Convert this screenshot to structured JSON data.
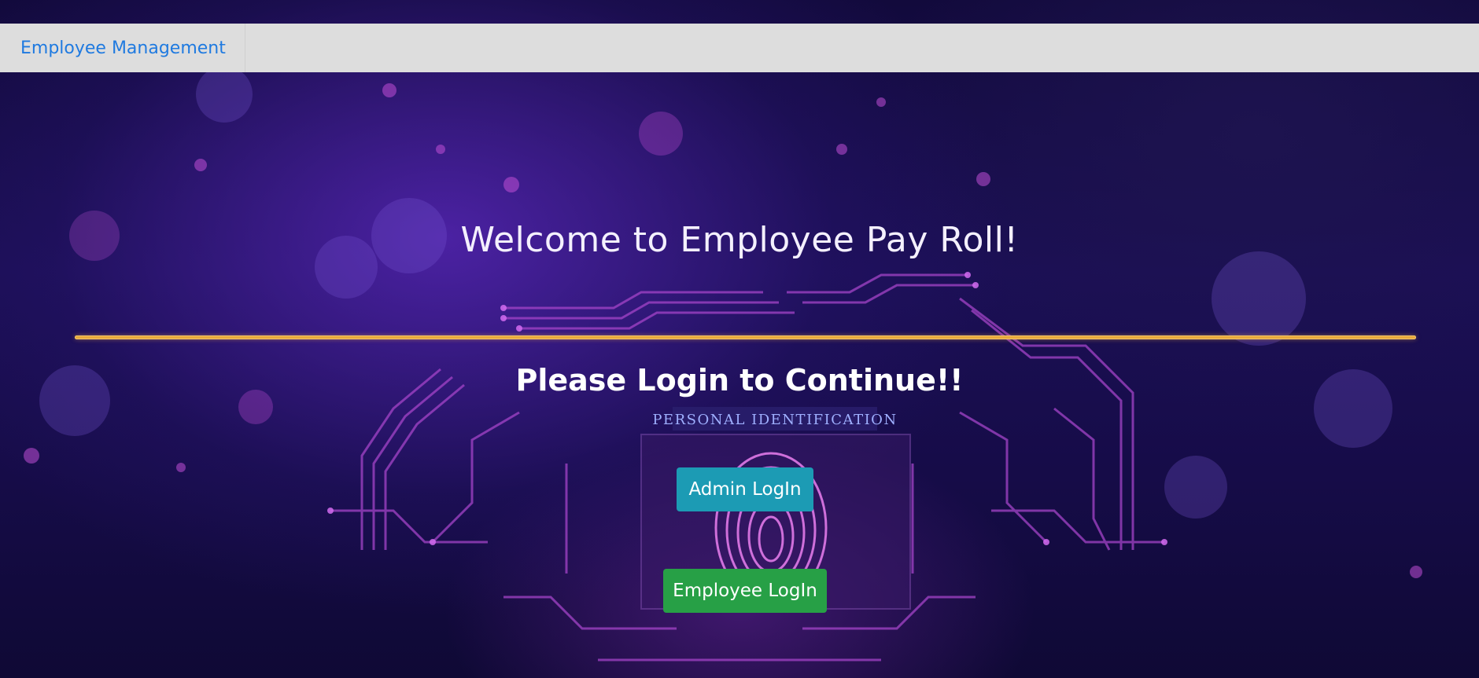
{
  "navbar": {
    "brand": "Employee Management"
  },
  "main": {
    "welcome_title": "Welcome to Employee Pay Roll!",
    "subtitle": "Please Login to Continue!!",
    "admin_button": "Admin LogIn",
    "employee_button": "Employee LogIn"
  },
  "background_image": {
    "panel_text": "PERSONAL IDENTIFICATION"
  },
  "colors": {
    "brand_link": "#1f7ae0",
    "navbar_bg": "#dddddd",
    "divider": "#e8a93c",
    "admin_button": "#1c9bb4",
    "employee_button": "#27a046"
  }
}
